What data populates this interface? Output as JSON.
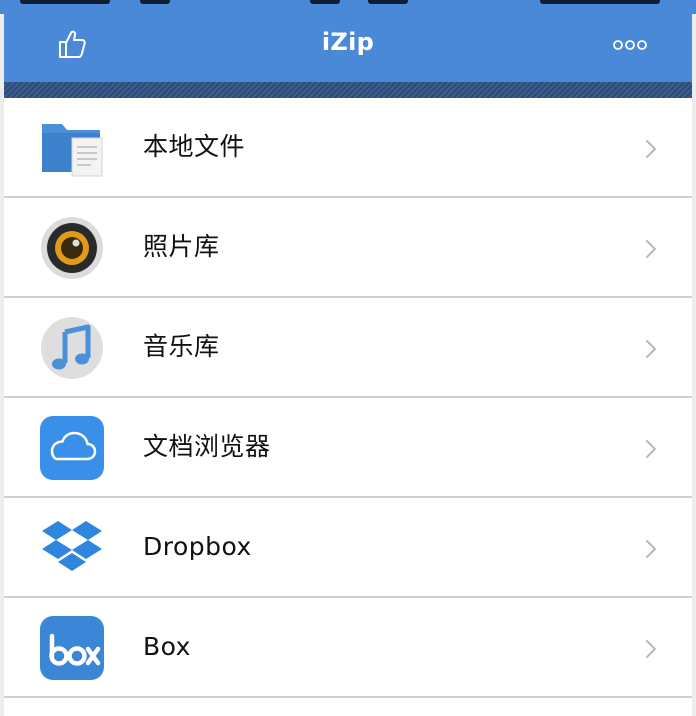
{
  "navbar": {
    "title": "iZip",
    "left_icon": "thumbs-up-icon",
    "right_icon": "more-icon"
  },
  "list": {
    "items": [
      {
        "label": "本地文件",
        "icon": "folder-icon"
      },
      {
        "label": "照片库",
        "icon": "camera-icon"
      },
      {
        "label": "音乐库",
        "icon": "music-icon"
      },
      {
        "label": "文档浏览器",
        "icon": "icloud-icon"
      },
      {
        "label": "Dropbox",
        "icon": "dropbox-icon"
      },
      {
        "label": "Box",
        "icon": "box-icon"
      }
    ]
  },
  "colors": {
    "nav_blue": "#4a89d8",
    "stripe_dark": "#2c4a76",
    "row_bg": "#ffffff",
    "separator": "#cfcfcf",
    "chevron": "#b9b9b9"
  }
}
